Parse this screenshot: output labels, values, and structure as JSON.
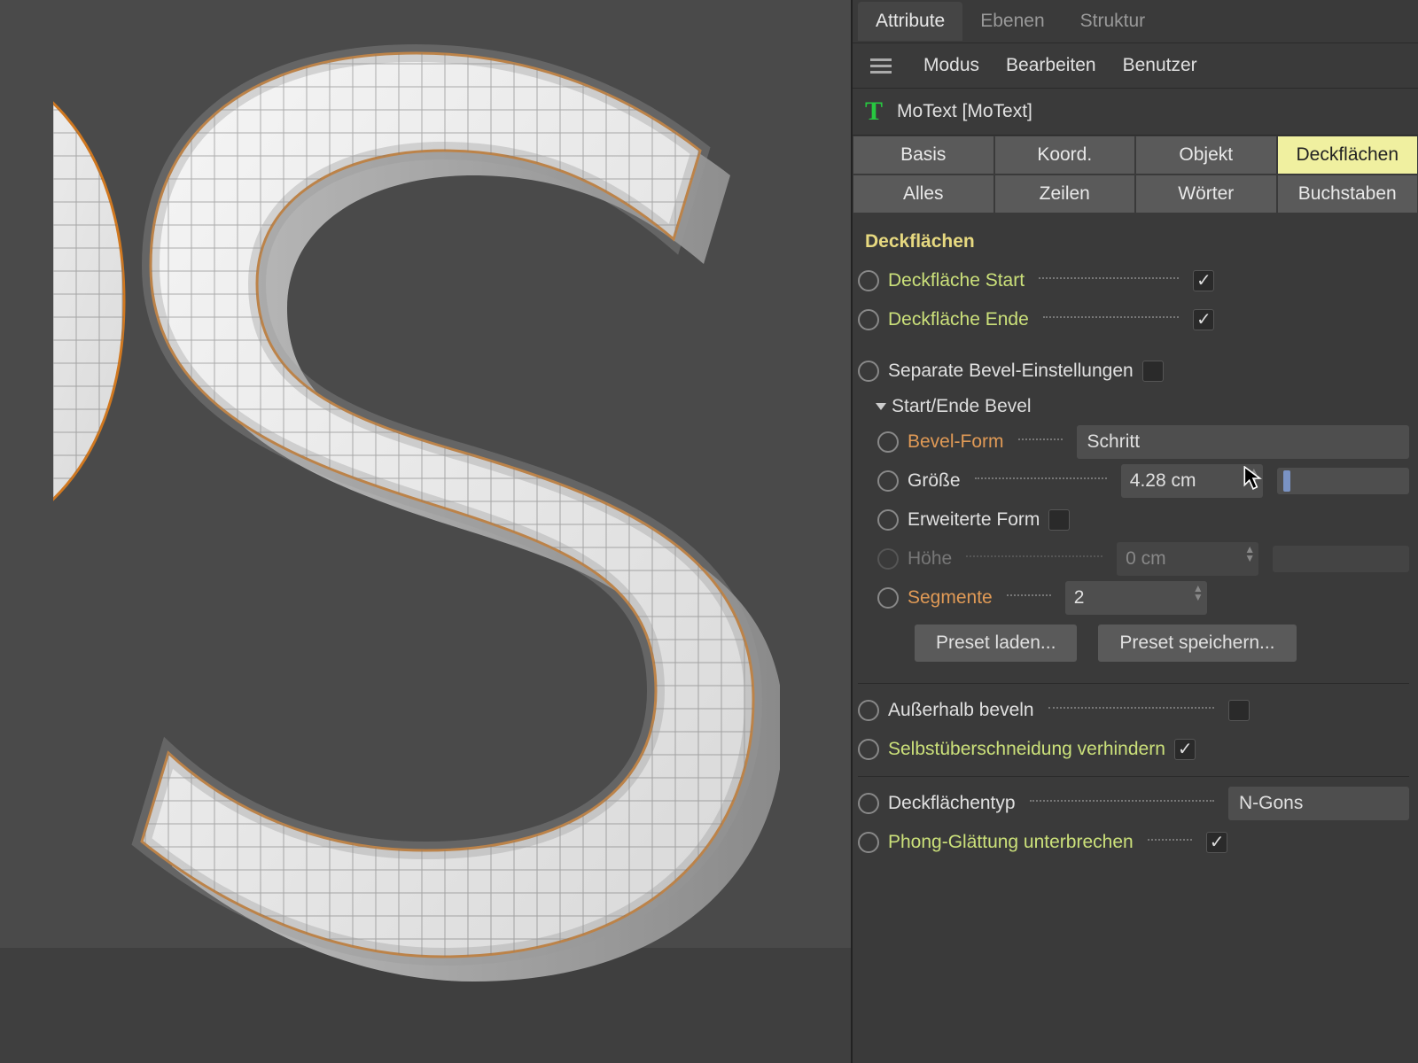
{
  "tabs": {
    "attribute": "Attribute",
    "ebenen": "Ebenen",
    "struktur": "Struktur"
  },
  "toolbar": {
    "modus": "Modus",
    "bearbeiten": "Bearbeiten",
    "benutzer": "Benutzer"
  },
  "object": {
    "name": "MoText [MoText]"
  },
  "proptab": {
    "basis": "Basis",
    "koord": "Koord.",
    "objekt": "Objekt",
    "deck": "Deckflächen",
    "alles": "Alles",
    "zeilen": "Zeilen",
    "woerter": "Wörter",
    "buchst": "Buchstaben"
  },
  "section": {
    "title": "Deckflächen"
  },
  "deck_start": {
    "label": "Deckfläche Start",
    "checked": true
  },
  "deck_ende": {
    "label": "Deckfläche Ende",
    "checked": true
  },
  "sep_bevel": {
    "label": "Separate Bevel-Einstellungen",
    "checked": false
  },
  "group": {
    "title": "Start/Ende Bevel"
  },
  "bevel_form": {
    "label": "Bevel-Form",
    "value": "Schritt"
  },
  "groesse": {
    "label": "Größe",
    "value": "4.28 cm"
  },
  "erw_form": {
    "label": "Erweiterte Form",
    "checked": false
  },
  "hoehe": {
    "label": "Höhe",
    "value": "0 cm"
  },
  "segmente": {
    "label": "Segmente",
    "value": "2"
  },
  "buttons": {
    "load": "Preset laden...",
    "save": "Preset speichern..."
  },
  "aussen": {
    "label": "Außerhalb beveln",
    "checked": false
  },
  "selbst": {
    "label": "Selbstüberschneidung verhindern",
    "checked": true
  },
  "decktyp": {
    "label": "Deckflächentyp",
    "value": "N-Gons"
  },
  "phong": {
    "label": "Phong-Glättung unterbrechen",
    "checked": true
  }
}
